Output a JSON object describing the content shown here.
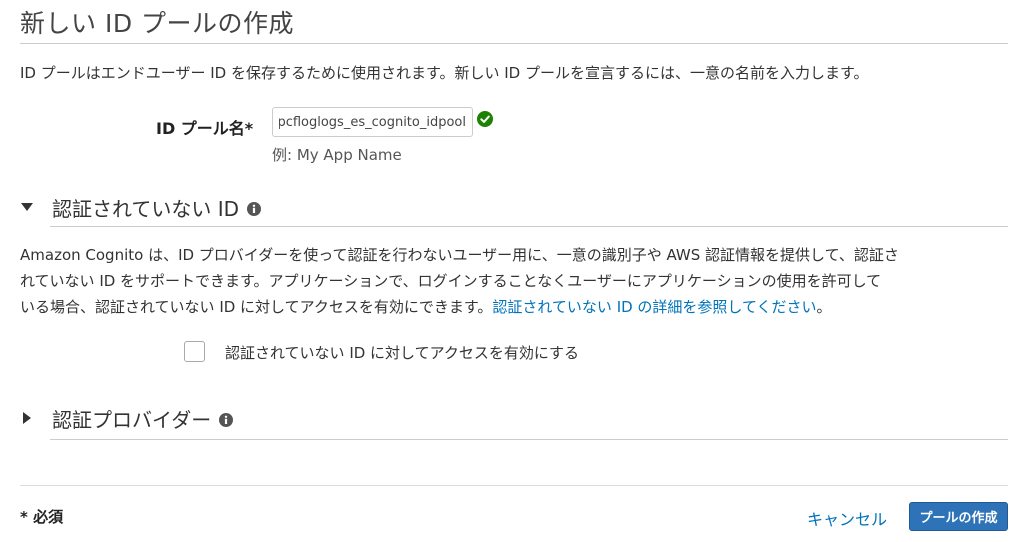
{
  "header": {
    "title": "新しい ID プールの作成",
    "intro": "ID プールはエンドユーザー ID を保存するために使用されます。新しい ID プールを宣言するには、一意の名前を入力します。"
  },
  "pool_name": {
    "label": "ID プール名*",
    "value": "vpcfloglogs_es_cognito_idpool",
    "example": "例: My App Name",
    "valid": true
  },
  "unauth_section": {
    "title": "認証されていない ID",
    "expanded": true,
    "desc_lines": [
      "Amazon Cognito は、ID プロバイダーを使って認証を行わないユーザー用に、一意の識別子や AWS 認証情報を提供して、認証さ",
      "れていない ID をサポートできます。アプリケーションで、ログインすることなくユーザーにアプリケーションの使用を許可して",
      "いる場合、認証されていない ID に対してアクセスを有効にできます。"
    ],
    "link_text": "認証されていない ID の詳細を参照してください",
    "link_suffix": "。",
    "checkbox_label": "認証されていない ID に対してアクセスを有効にする",
    "checkbox_checked": false
  },
  "auth_providers_section": {
    "title": "認証プロバイダー",
    "expanded": false
  },
  "footer": {
    "required_note": "* 必須",
    "cancel_label": "キャンセル",
    "create_label": "プールの作成"
  },
  "colors": {
    "link": "#0073bb",
    "primary_button": "#2e73b8",
    "valid_check": "#1d8102"
  }
}
